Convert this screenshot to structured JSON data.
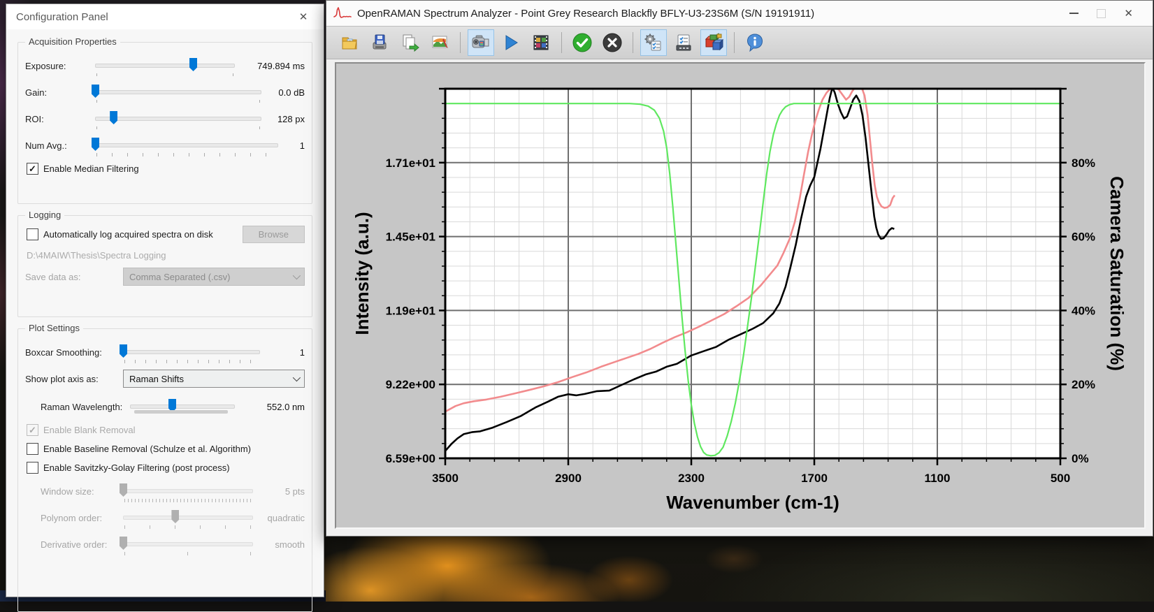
{
  "config_panel": {
    "title": "Configuration Panel",
    "close_glyph": "✕",
    "groups": {
      "acquisition": {
        "legend": "Acquisition Properties",
        "exposure": {
          "label": "Exposure:",
          "value": "749.894 ms",
          "pct": 70
        },
        "gain": {
          "label": "Gain:",
          "value": "0.0 dB",
          "pct": 0
        },
        "roi": {
          "label": "ROI:",
          "value": "128 px",
          "pct": 11
        },
        "numavg": {
          "label": "Num Avg.:",
          "value": "1",
          "pct": 0
        },
        "median_filter": {
          "label": "Enable Median Filtering",
          "checked": true,
          "disabled": false
        }
      },
      "logging": {
        "legend": "Logging",
        "autolog": {
          "label": "Automatically log acquired spectra on disk",
          "checked": false,
          "disabled": false
        },
        "browse_button": "Browse",
        "path": "D:\\4MAIW\\Thesis\\Spectra Logging",
        "save_as_label": "Save data as:",
        "save_as_value": "Comma Separated (.csv)"
      },
      "plot": {
        "legend": "Plot Settings",
        "boxcar": {
          "label": "Boxcar Smoothing:",
          "value": "1",
          "pct": 0
        },
        "axis_label": "Show plot axis as:",
        "axis_value": "Raman Shifts",
        "wavelength": {
          "label": "Raman Wavelength:",
          "value": "552.0 nm",
          "pct": 40
        },
        "blank_removal": {
          "label": "Enable Blank Removal",
          "checked": true,
          "disabled": true
        },
        "baseline_removal": {
          "label": "Enable Baseline Removal (Schulze et al. Algorithm)",
          "checked": false,
          "disabled": false
        },
        "savgol": {
          "label": "Enable Savitzky-Golay Filtering (post process)",
          "checked": false,
          "disabled": false
        },
        "window_size": {
          "label": "Window size:",
          "value": "5 pts",
          "pct": 0,
          "disabled": true
        },
        "polynom": {
          "label": "Polynom order:",
          "value": "quadratic",
          "pct": 40,
          "disabled": true
        },
        "derivative": {
          "label": "Derivative order:",
          "value": "smooth",
          "pct": 0,
          "disabled": true
        }
      }
    }
  },
  "analyzer": {
    "title": "OpenRAMAN Spectrum Analyzer - Point Grey Research Blackfly BFLY-U3-23S6M (S/N 19191911)",
    "close_glyph": "✕",
    "toolbar": [
      {
        "name": "open-folder-icon"
      },
      {
        "name": "save-icon"
      },
      {
        "name": "copy-icon"
      },
      {
        "name": "image-export-icon"
      },
      {
        "sep": true
      },
      {
        "name": "camera-icon",
        "selected": true
      },
      {
        "name": "play-icon"
      },
      {
        "name": "film-icon"
      },
      {
        "sep": true
      },
      {
        "name": "accept-icon"
      },
      {
        "name": "cancel-icon"
      },
      {
        "sep": true
      },
      {
        "name": "acquisition-settings-icon",
        "selected": true
      },
      {
        "name": "processing-settings-icon"
      },
      {
        "name": "chart-options-icon",
        "selected": true
      },
      {
        "sep": true
      },
      {
        "name": "info-icon"
      }
    ]
  },
  "chart_data": {
    "type": "line",
    "xlabel": "Wavenumber (cm-1)",
    "ylabel_left": "Intensity (a.u.)",
    "ylabel_right": "Camera Saturation (%)",
    "x_range": [
      3500,
      500
    ],
    "x_tick_values": [
      3500,
      2900,
      2300,
      1700,
      1100,
      500
    ],
    "x_tick_labels": [
      "3500",
      "2900",
      "2300",
      "1700",
      "1100",
      "500"
    ],
    "y_left_range": [
      6.59,
      19.7
    ],
    "y_left_tick_labels": [
      "6.59e+00",
      "9.22e+00",
      "1.19e+01",
      "1.45e+01",
      "1.71e+01"
    ],
    "y_right_range": [
      0,
      100
    ],
    "y_right_tick_labels": [
      "0%",
      "20%",
      "40%",
      "60%",
      "80%"
    ],
    "grid": "major+minor",
    "legend": "none",
    "series": [
      {
        "name": "live-spectrum",
        "color": "#000000",
        "width": 2.6,
        "axis": "left",
        "points": [
          [
            3500,
            6.85
          ],
          [
            3470,
            7.1
          ],
          [
            3440,
            7.3
          ],
          [
            3410,
            7.45
          ],
          [
            3370,
            7.52
          ],
          [
            3330,
            7.55
          ],
          [
            3270,
            7.68
          ],
          [
            3200,
            7.88
          ],
          [
            3130,
            8.1
          ],
          [
            3060,
            8.4
          ],
          [
            3000,
            8.6
          ],
          [
            2950,
            8.78
          ],
          [
            2900,
            8.87
          ],
          [
            2860,
            8.83
          ],
          [
            2820,
            8.88
          ],
          [
            2760,
            8.98
          ],
          [
            2700,
            9.0
          ],
          [
            2640,
            9.2
          ],
          [
            2580,
            9.4
          ],
          [
            2520,
            9.58
          ],
          [
            2470,
            9.68
          ],
          [
            2420,
            9.85
          ],
          [
            2370,
            9.95
          ],
          [
            2300,
            10.25
          ],
          [
            2240,
            10.4
          ],
          [
            2180,
            10.55
          ],
          [
            2120,
            10.8
          ],
          [
            2060,
            11.0
          ],
          [
            2000,
            11.2
          ],
          [
            1950,
            11.4
          ],
          [
            1900,
            11.75
          ],
          [
            1870,
            12.1
          ],
          [
            1840,
            12.7
          ],
          [
            1816,
            13.4
          ],
          [
            1790,
            14.2
          ],
          [
            1765,
            15.1
          ],
          [
            1740,
            15.9
          ],
          [
            1720,
            16.3
          ],
          [
            1700,
            16.6
          ],
          [
            1685,
            17.1
          ],
          [
            1670,
            17.6
          ],
          [
            1655,
            18.2
          ],
          [
            1640,
            18.8
          ],
          [
            1625,
            19.4
          ],
          [
            1612,
            19.78
          ],
          [
            1600,
            19.6
          ],
          [
            1585,
            19.2
          ],
          [
            1570,
            18.9
          ],
          [
            1555,
            18.68
          ],
          [
            1540,
            18.75
          ],
          [
            1525,
            19.05
          ],
          [
            1510,
            19.35
          ],
          [
            1495,
            19.5
          ],
          [
            1480,
            19.3
          ],
          [
            1465,
            18.8
          ],
          [
            1450,
            18.0
          ],
          [
            1435,
            17.0
          ],
          [
            1420,
            16.0
          ],
          [
            1408,
            15.2
          ],
          [
            1398,
            14.8
          ],
          [
            1388,
            14.55
          ],
          [
            1375,
            14.4
          ],
          [
            1362,
            14.42
          ],
          [
            1348,
            14.55
          ],
          [
            1335,
            14.7
          ],
          [
            1322,
            14.78
          ],
          [
            1310,
            14.75
          ]
        ]
      },
      {
        "name": "reference-spectrum",
        "color": "#f28b8d",
        "width": 2.6,
        "axis": "left",
        "points": [
          [
            3500,
            8.25
          ],
          [
            3450,
            8.45
          ],
          [
            3410,
            8.55
          ],
          [
            3360,
            8.62
          ],
          [
            3300,
            8.68
          ],
          [
            3230,
            8.78
          ],
          [
            3160,
            8.9
          ],
          [
            3090,
            9.02
          ],
          [
            3020,
            9.15
          ],
          [
            2950,
            9.3
          ],
          [
            2880,
            9.48
          ],
          [
            2810,
            9.65
          ],
          [
            2740,
            9.85
          ],
          [
            2680,
            10.0
          ],
          [
            2620,
            10.15
          ],
          [
            2560,
            10.3
          ],
          [
            2500,
            10.48
          ],
          [
            2440,
            10.7
          ],
          [
            2380,
            10.9
          ],
          [
            2320,
            11.08
          ],
          [
            2260,
            11.28
          ],
          [
            2200,
            11.5
          ],
          [
            2140,
            11.72
          ],
          [
            2080,
            12.0
          ],
          [
            2020,
            12.3
          ],
          [
            1960,
            12.75
          ],
          [
            1920,
            13.1
          ],
          [
            1880,
            13.45
          ],
          [
            1850,
            13.9
          ],
          [
            1820,
            14.4
          ],
          [
            1795,
            15.0
          ],
          [
            1772,
            15.8
          ],
          [
            1750,
            16.7
          ],
          [
            1730,
            17.5
          ],
          [
            1712,
            18.1
          ],
          [
            1695,
            18.6
          ],
          [
            1678,
            19.0
          ],
          [
            1660,
            19.35
          ],
          [
            1640,
            19.6
          ],
          [
            1620,
            19.75
          ],
          [
            1600,
            19.8
          ],
          [
            1580,
            19.7
          ],
          [
            1560,
            19.5
          ],
          [
            1545,
            19.35
          ],
          [
            1530,
            19.45
          ],
          [
            1515,
            19.65
          ],
          [
            1500,
            19.8
          ],
          [
            1485,
            19.85
          ],
          [
            1470,
            19.8
          ],
          [
            1455,
            19.5
          ],
          [
            1440,
            18.8
          ],
          [
            1428,
            17.9
          ],
          [
            1416,
            17.0
          ],
          [
            1405,
            16.3
          ],
          [
            1395,
            15.9
          ],
          [
            1385,
            15.7
          ],
          [
            1372,
            15.55
          ],
          [
            1358,
            15.5
          ],
          [
            1344,
            15.52
          ],
          [
            1330,
            15.6
          ],
          [
            1318,
            15.85
          ],
          [
            1308,
            15.95
          ]
        ]
      },
      {
        "name": "camera-saturation",
        "color": "#5fe85f",
        "width": 2.2,
        "axis": "right",
        "points": [
          [
            3500,
            96
          ],
          [
            2600,
            96
          ],
          [
            2550,
            95.8
          ],
          [
            2510,
            95.3
          ],
          [
            2480,
            94.2
          ],
          [
            2455,
            92
          ],
          [
            2435,
            88.5
          ],
          [
            2420,
            84
          ],
          [
            2405,
            77
          ],
          [
            2390,
            68
          ],
          [
            2375,
            58
          ],
          [
            2360,
            48
          ],
          [
            2345,
            38
          ],
          [
            2330,
            29
          ],
          [
            2315,
            21
          ],
          [
            2300,
            14.5
          ],
          [
            2285,
            9.5
          ],
          [
            2270,
            5.8
          ],
          [
            2255,
            3.2
          ],
          [
            2240,
            1.6
          ],
          [
            2225,
            0.9
          ],
          [
            2205,
            0.7
          ],
          [
            2185,
            0.8
          ],
          [
            2165,
            1.5
          ],
          [
            2145,
            3
          ],
          [
            2125,
            6
          ],
          [
            2105,
            10
          ],
          [
            2085,
            15
          ],
          [
            2065,
            21
          ],
          [
            2045,
            28
          ],
          [
            2025,
            36
          ],
          [
            2005,
            44
          ],
          [
            1985,
            53
          ],
          [
            1965,
            62
          ],
          [
            1948,
            70
          ],
          [
            1932,
            77
          ],
          [
            1916,
            83
          ],
          [
            1900,
            87.5
          ],
          [
            1885,
            90.5
          ],
          [
            1870,
            92.8
          ],
          [
            1855,
            94.2
          ],
          [
            1840,
            95.1
          ],
          [
            1820,
            95.7
          ],
          [
            1800,
            96
          ],
          [
            500,
            96
          ]
        ]
      }
    ]
  }
}
